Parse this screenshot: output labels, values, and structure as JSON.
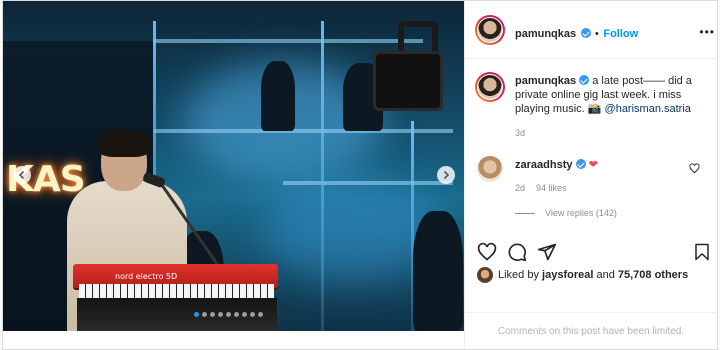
{
  "post": {
    "author": "pamunqkas",
    "follow_label": "Follow",
    "more_label": "•••",
    "media": {
      "neon_text": "KAS",
      "keyboard_label": "nord electro 5D",
      "carousel_dots": 9,
      "active_dot": 0
    },
    "caption": {
      "username": "pamunqkas",
      "text": " a late post—— did a private online gig last week. i miss playing music. ",
      "emoji": "📸",
      "mention": "@harisman.satria",
      "time": "3d"
    },
    "comment": {
      "username": "zaraadhsty",
      "heart": "❤",
      "time": "2d",
      "likes": "94 likes",
      "view_replies": "View replies (142)"
    },
    "likes": {
      "prefix": "Liked by ",
      "user": "jaysforeal",
      "mid": " and ",
      "count": "75,708 others"
    },
    "footer": "Comments on this post have been limited.",
    "colors": {
      "accent": "#0095f6",
      "verified": "#3897f0",
      "heart": "#ed4956",
      "muted": "#8e8e8e"
    },
    "icons": [
      "chevron-left-icon",
      "chevron-right-icon",
      "verified-icon",
      "heart-icon",
      "comment-icon",
      "share-icon",
      "bookmark-icon"
    ]
  }
}
